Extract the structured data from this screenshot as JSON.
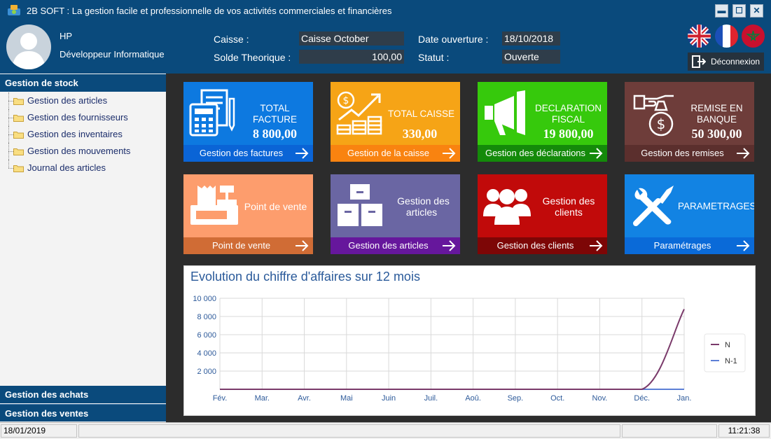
{
  "window": {
    "title": "2B SOFT : La gestion facile et professionnelle de vos activités commerciales et financières",
    "buttons": {
      "minimize": "▬",
      "maximize": "☐",
      "close": "✕"
    }
  },
  "user": {
    "name": "HP",
    "role": "Développeur Informatique"
  },
  "header": {
    "caisse_label": "Caisse :",
    "caisse_value": "Caisse October",
    "solde_label": "Solde Theorique  :",
    "solde_value": "100,00",
    "date_label": "Date ouverture :",
    "date_value": "18/10/2018",
    "statut_label": "Statut :",
    "statut_value": "Ouverte",
    "logout_label": "Déconnexion"
  },
  "sidebar": {
    "stock_header": "Gestion de stock",
    "items": [
      {
        "label": "Gestion des articles"
      },
      {
        "label": "Gestion des fournisseurs"
      },
      {
        "label": "Gestion des inventaires"
      },
      {
        "label": "Gestion des mouvements"
      },
      {
        "label": "Journal des articles"
      }
    ],
    "achats_header": "Gestion des achats",
    "ventes_header": "Gestion des ventes"
  },
  "tiles": {
    "factures": {
      "line1": "TOTAL",
      "line2": "FACTURE",
      "amount": "8 800,00",
      "footer": "Gestion des factures",
      "color": "#0d79e0",
      "footer_color": "#0a64d6"
    },
    "caisse": {
      "line1": "TOTAL CAISSE",
      "amount": "330,00",
      "footer": "Gestion de la caisse",
      "color": "#f6a416",
      "footer_color": "#f98310"
    },
    "declarations": {
      "line1": "DECLARATION",
      "line2": "FISCAL",
      "amount": "19 800,00",
      "footer": "Gestion des déclarations",
      "color": "#36c90c",
      "footer_color": "#148a0a"
    },
    "remises": {
      "line1": "REMISE EN",
      "line2": "BANQUE",
      "amount": "50 300,00",
      "footer": "Gestion des remises",
      "color": "#6e3d3a",
      "footer_color": "#5b2f2d"
    },
    "pointvente": {
      "line1": "Point de vente",
      "footer": "Point de vente",
      "color": "#fd9d6d",
      "footer_color": "#d06c35"
    },
    "articles": {
      "line1": "Gestion des",
      "line2": "articles",
      "footer": "Gestion des articles",
      "color": "#6a66a3",
      "footer_color": "#66179c"
    },
    "clients": {
      "line1": "Gestion des",
      "line2": "clients",
      "footer": "Gestion des clients",
      "color": "#c10a0a",
      "footer_color": "#7d0606"
    },
    "parametrages": {
      "line1": "PARAMETRAGES",
      "footer": "Paramétrages",
      "color": "#1283e3",
      "footer_color": "#0a6ad8"
    }
  },
  "chart": {
    "title": "Evolution du chiffre d'affaires sur 12 mois"
  },
  "chart_data": {
    "type": "line",
    "title": "Evolution du chiffre d'affaires sur 12 mois",
    "categories": [
      "Fév.",
      "Mar.",
      "Avr.",
      "Mai",
      "Juin",
      "Juil.",
      "Aoû.",
      "Sep.",
      "Oct.",
      "Nov.",
      "Déc.",
      "Jan."
    ],
    "yticks": [
      "10 000",
      "8 000",
      "6 000",
      "4 000",
      "2 000"
    ],
    "ylim": [
      0,
      10000
    ],
    "grid": true,
    "legend_position": "right",
    "series": [
      {
        "name": "N",
        "color": "#7a3a6a",
        "values": [
          0,
          0,
          0,
          0,
          0,
          0,
          0,
          0,
          0,
          0,
          0,
          8800
        ]
      },
      {
        "name": "N-1",
        "color": "#5c7fd6",
        "values": [
          0,
          0,
          0,
          0,
          0,
          0,
          0,
          0,
          0,
          0,
          0,
          0
        ]
      }
    ]
  },
  "statusbar": {
    "date": "18/01/2019",
    "time": "11:21:38"
  }
}
